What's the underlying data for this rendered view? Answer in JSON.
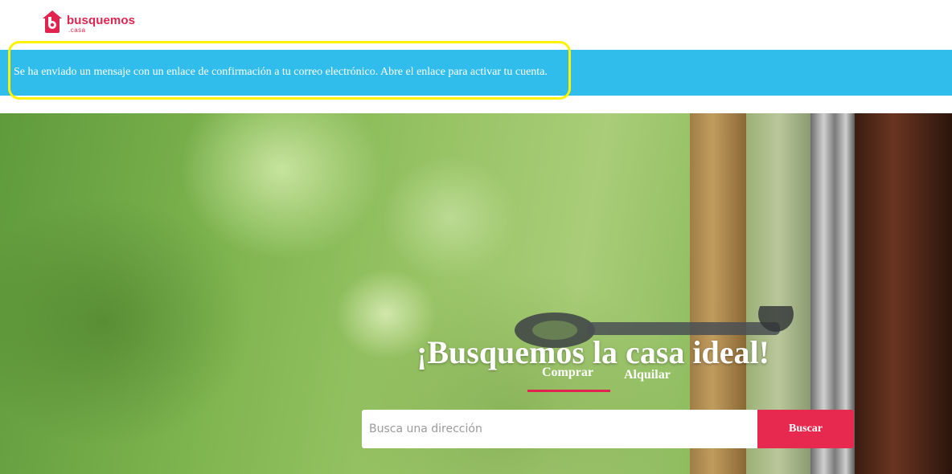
{
  "logo": {
    "name": "busquemos",
    "suffix": ".casa"
  },
  "alert": {
    "message": "Se ha enviado un mensaje con un enlace de confirmación a tu correo electrónico. Abre el enlace para activar tu cuenta."
  },
  "hero": {
    "title": "¡Busquemos la casa ideal!",
    "tabs": [
      {
        "label": "Comprar",
        "active": true
      },
      {
        "label": "Alquilar",
        "active": false
      }
    ],
    "search": {
      "placeholder": "Busca una dirección",
      "value": "",
      "button_label": "Buscar"
    }
  },
  "colors": {
    "brand": "#e0244f",
    "alert_bg": "#30bdec",
    "highlight": "#fff200"
  }
}
